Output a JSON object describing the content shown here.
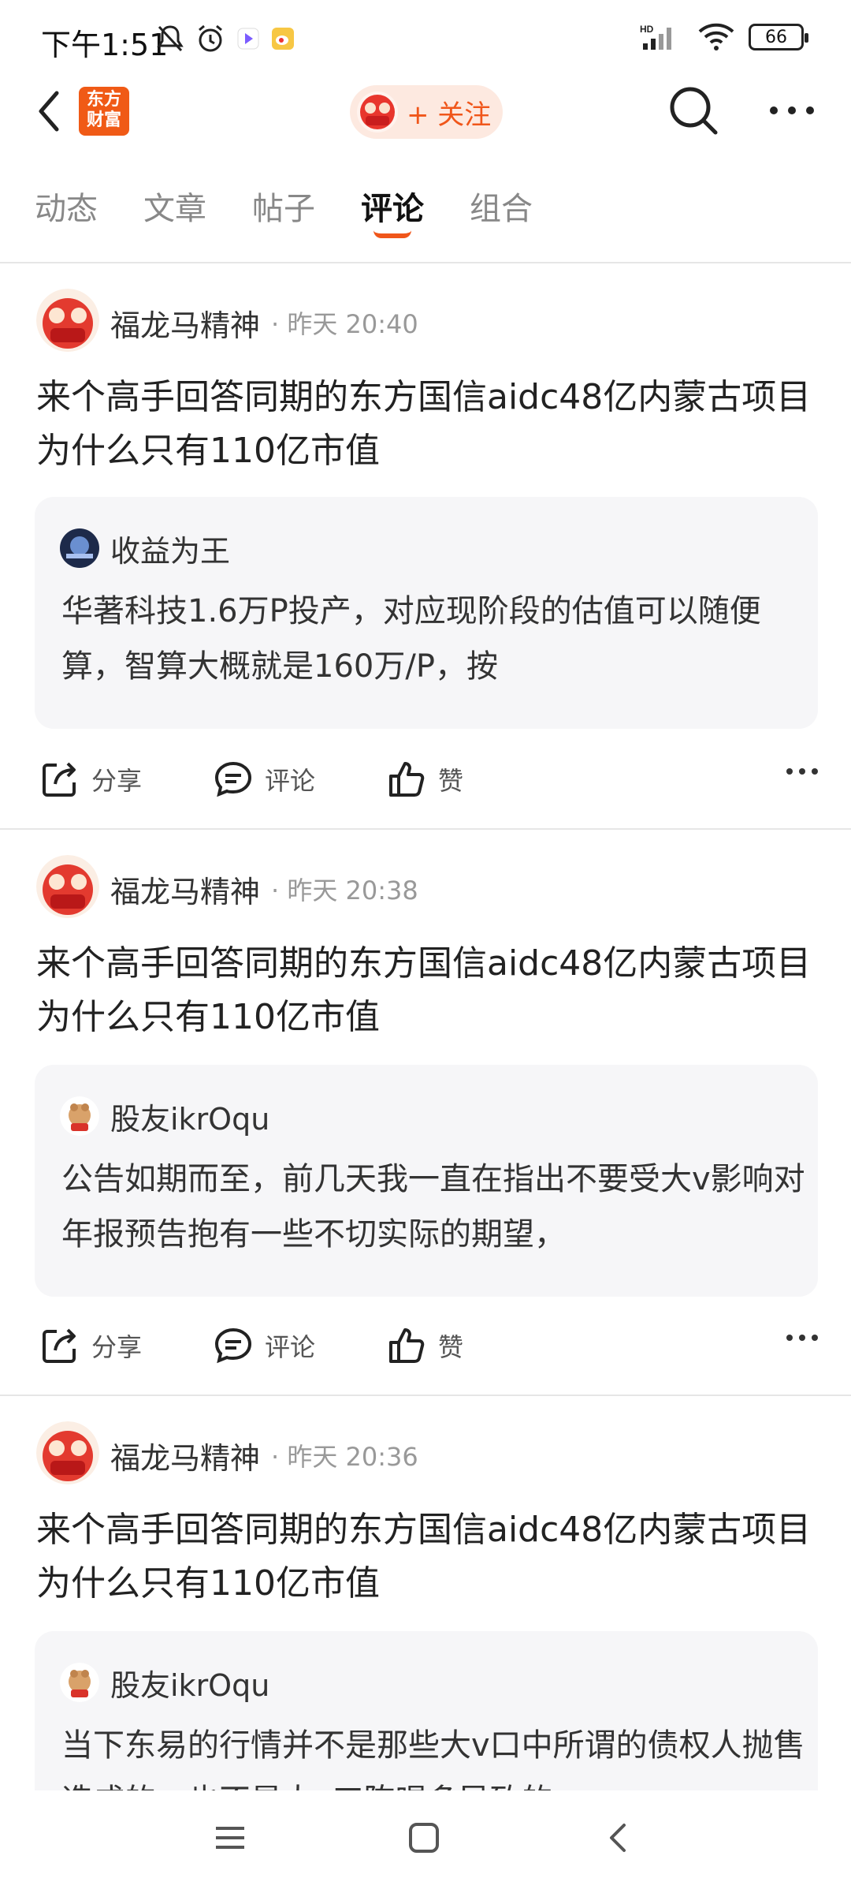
{
  "status_bar": {
    "time": "下午1:51",
    "network": "HD",
    "battery": "66"
  },
  "header": {
    "logo_text": "东方财富",
    "follow_label": "+ 关注"
  },
  "tabs": [
    {
      "label": "动态"
    },
    {
      "label": "文章"
    },
    {
      "label": "帖子"
    },
    {
      "label": "评论"
    },
    {
      "label": "组合"
    }
  ],
  "active_tab": "评论",
  "posts": [
    {
      "author": "福龙马精神",
      "time": "昨天 20:40",
      "body": "来个高手回答同期的东方国信aidc48亿内蒙古项目为什么只有110亿市值",
      "quote_author": "收益为王",
      "quote_text": "华著科技1.6万P投产，对应现阶段的估值可以随便算，智算大概就是160万/P，按"
    },
    {
      "author": "福龙马精神",
      "time": "昨天 20:38",
      "body": "来个高手回答同期的东方国信aidc48亿内蒙古项目为什么只有110亿市值",
      "quote_author": "股友ikrOqu",
      "quote_text": "公告如期而至，前几天我一直在指出不要受大v影响对年报预告抱有一些不切实际的期望，"
    },
    {
      "author": "福龙马精神",
      "time": "昨天 20:36",
      "body": "来个高手回答同期的东方国信aidc48亿内蒙古项目为什么只有110亿市值",
      "quote_author": "股友ikrOqu",
      "quote_text": "当下东易的行情并不是那些大v口中所谓的债权人抛售造成的，也不是大v工陈喝多导致的"
    }
  ],
  "actions": {
    "share": "分享",
    "comment": "评论",
    "like": "赞"
  },
  "colors": {
    "accent": "#f0561a",
    "quote_bg": "#f6f6f8"
  }
}
